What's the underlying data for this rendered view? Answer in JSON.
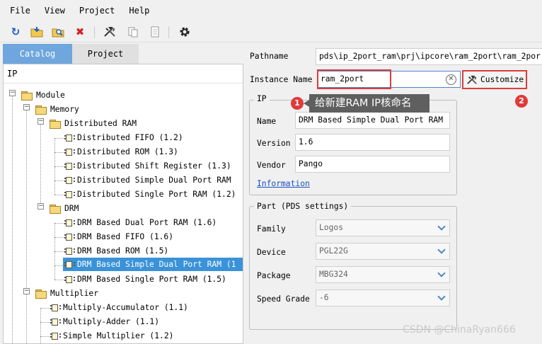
{
  "menu": {
    "items": [
      "File",
      "View",
      "Project",
      "Help"
    ]
  },
  "toolbar": {
    "icons": [
      "refresh-icon",
      "open-folder-icon",
      "search-icon",
      "delete-icon",
      "build-icon",
      "copy-icon",
      "document-icon",
      "settings-icon"
    ],
    "colors": {
      "refresh": "#1f5fbf",
      "delete": "#d81e1e"
    }
  },
  "tabs": {
    "catalog": "Catalog",
    "project": "Project"
  },
  "tree": {
    "header": "IP",
    "module": "Module",
    "memory": "Memory",
    "distributed_ram": "Distributed RAM",
    "dist_items": [
      "Distributed FIFO (1.2)",
      "Distributed ROM (1.3)",
      "Distributed Shift Register (1.3)",
      "Distributed Simple Dual Port RAM",
      "Distributed Single Port RAM (1.2)"
    ],
    "drm": "DRM",
    "drm_items": [
      "DRM Based Dual Port RAM (1.6)",
      "DRM Based FIFO (1.6)",
      "DRM Based ROM (1.5)",
      "DRM Based Simple Dual Port RAM (1",
      "DRM Based Single Port RAM (1.5)"
    ],
    "multiplier": "Multiplier",
    "mult_items": [
      "Multiply-Accumulator (1.1)",
      "Multiply-Adder (1.1)",
      "Simple Multiplier (1.2)"
    ]
  },
  "form": {
    "pathname_label": "Pathname",
    "pathname_value": "pds\\ip_2port_ram\\prj\\ipcore\\ram_2port\\ram_2por",
    "instance_label": "Instance Name",
    "instance_value": "ram_2port",
    "customize_label": "Customize",
    "ip_group": "IP",
    "name_label": "Name",
    "name_value": "DRM Based Simple Dual Port RAM",
    "version_label": "Version",
    "version_value": "1.6",
    "vendor_label": "Vendor",
    "vendor_value": "Pango",
    "info_link": "Information",
    "part_group": "Part (PDS settings)",
    "family_label": "Family",
    "family_value": "Logos",
    "device_label": "Device",
    "device_value": "PGL22G",
    "package_label": "Package",
    "package_value": "MBG324",
    "speed_label": "Speed Grade",
    "speed_value": "-6"
  },
  "annotation": {
    "badge1": "1",
    "badge2": "2",
    "tooltip": "给新建RAM IP核命名"
  },
  "watermark": "CSDN @ChinaRyan666",
  "colors": {
    "selection": "#3a92d8",
    "tab_active": "#6ea6dd",
    "highlight": "#e03a3a",
    "link": "#1a4fc0"
  }
}
